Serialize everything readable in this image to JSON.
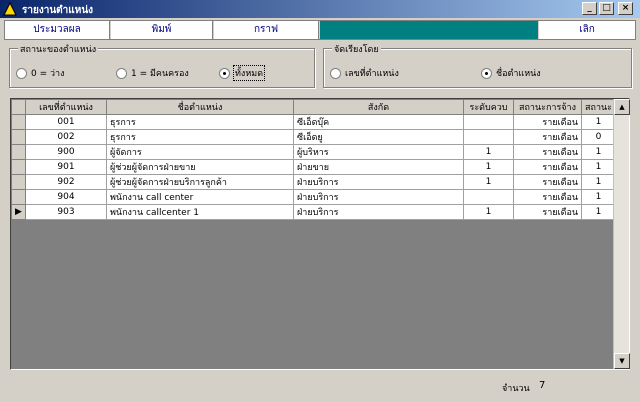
{
  "window": {
    "title": "รายงานตำแหน่ง",
    "minimize_glyph": "_",
    "restore_glyph": "□",
    "close_glyph": "×"
  },
  "toolbar": {
    "preview_label": "ประมวลผล",
    "print_label": "พิมพ์",
    "graph_label": "กราฟ",
    "exit_label": "เลิก",
    "highlight_color": "#008080"
  },
  "status_group": {
    "legend": "สถานะของตำแหน่ง",
    "options": [
      "0 = ว่าง",
      "1 = มีคนครอง",
      "ทั้งหมด"
    ],
    "selected": "ทั้งหมด"
  },
  "sort_group": {
    "legend": "จัดเรียงโดย",
    "options": [
      "เลขที่ตำแหน่ง",
      "ชื่อตำแหน่ง"
    ],
    "selected": "ชื่อตำแหน่ง"
  },
  "grid": {
    "columns": [
      "เลขที่ตำแหน่ง",
      "ชื่อตำแหน่ง",
      "สังกัด",
      "ระดับควบ",
      "สถานะการจ้าง",
      "สถานะ"
    ],
    "rows": [
      {
        "code": "001",
        "name": "ธุรการ",
        "dept": "ซีเอ็ดบุ๊ค",
        "level": "",
        "employment": "รายเดือน",
        "status": "1"
      },
      {
        "code": "002",
        "name": "ธุรการ",
        "dept": "ซีเอ็ดยู",
        "level": "",
        "employment": "รายเดือน",
        "status": "0"
      },
      {
        "code": "900",
        "name": "ผู้จัดการ",
        "dept": "ผู้บริหาร",
        "level": "1",
        "employment": "รายเดือน",
        "status": "1"
      },
      {
        "code": "901",
        "name": "ผู้ช่วยผู้จัดการฝ่ายขาย",
        "dept": "ฝ่ายขาย",
        "level": "1",
        "employment": "รายเดือน",
        "status": "1"
      },
      {
        "code": "902",
        "name": "ผู้ช่วยผู้จัดการฝ่ายบริการลูกค้า",
        "dept": "ฝ่ายบริการ",
        "level": "1",
        "employment": "รายเดือน",
        "status": "1"
      },
      {
        "code": "904",
        "name": "พนักงาน call center",
        "dept": "ฝ่ายบริการ",
        "level": "",
        "employment": "รายเดือน",
        "status": "1"
      },
      {
        "code": "903",
        "name": "พนักงาน callcenter 1",
        "dept": "ฝ่ายบริการ",
        "level": "1",
        "employment": "รายเดือน",
        "status": "1"
      }
    ],
    "current_row_indicator": "▶",
    "current_row": 6
  },
  "footer": {
    "count_label": "จำนวน",
    "count_value": "7"
  }
}
